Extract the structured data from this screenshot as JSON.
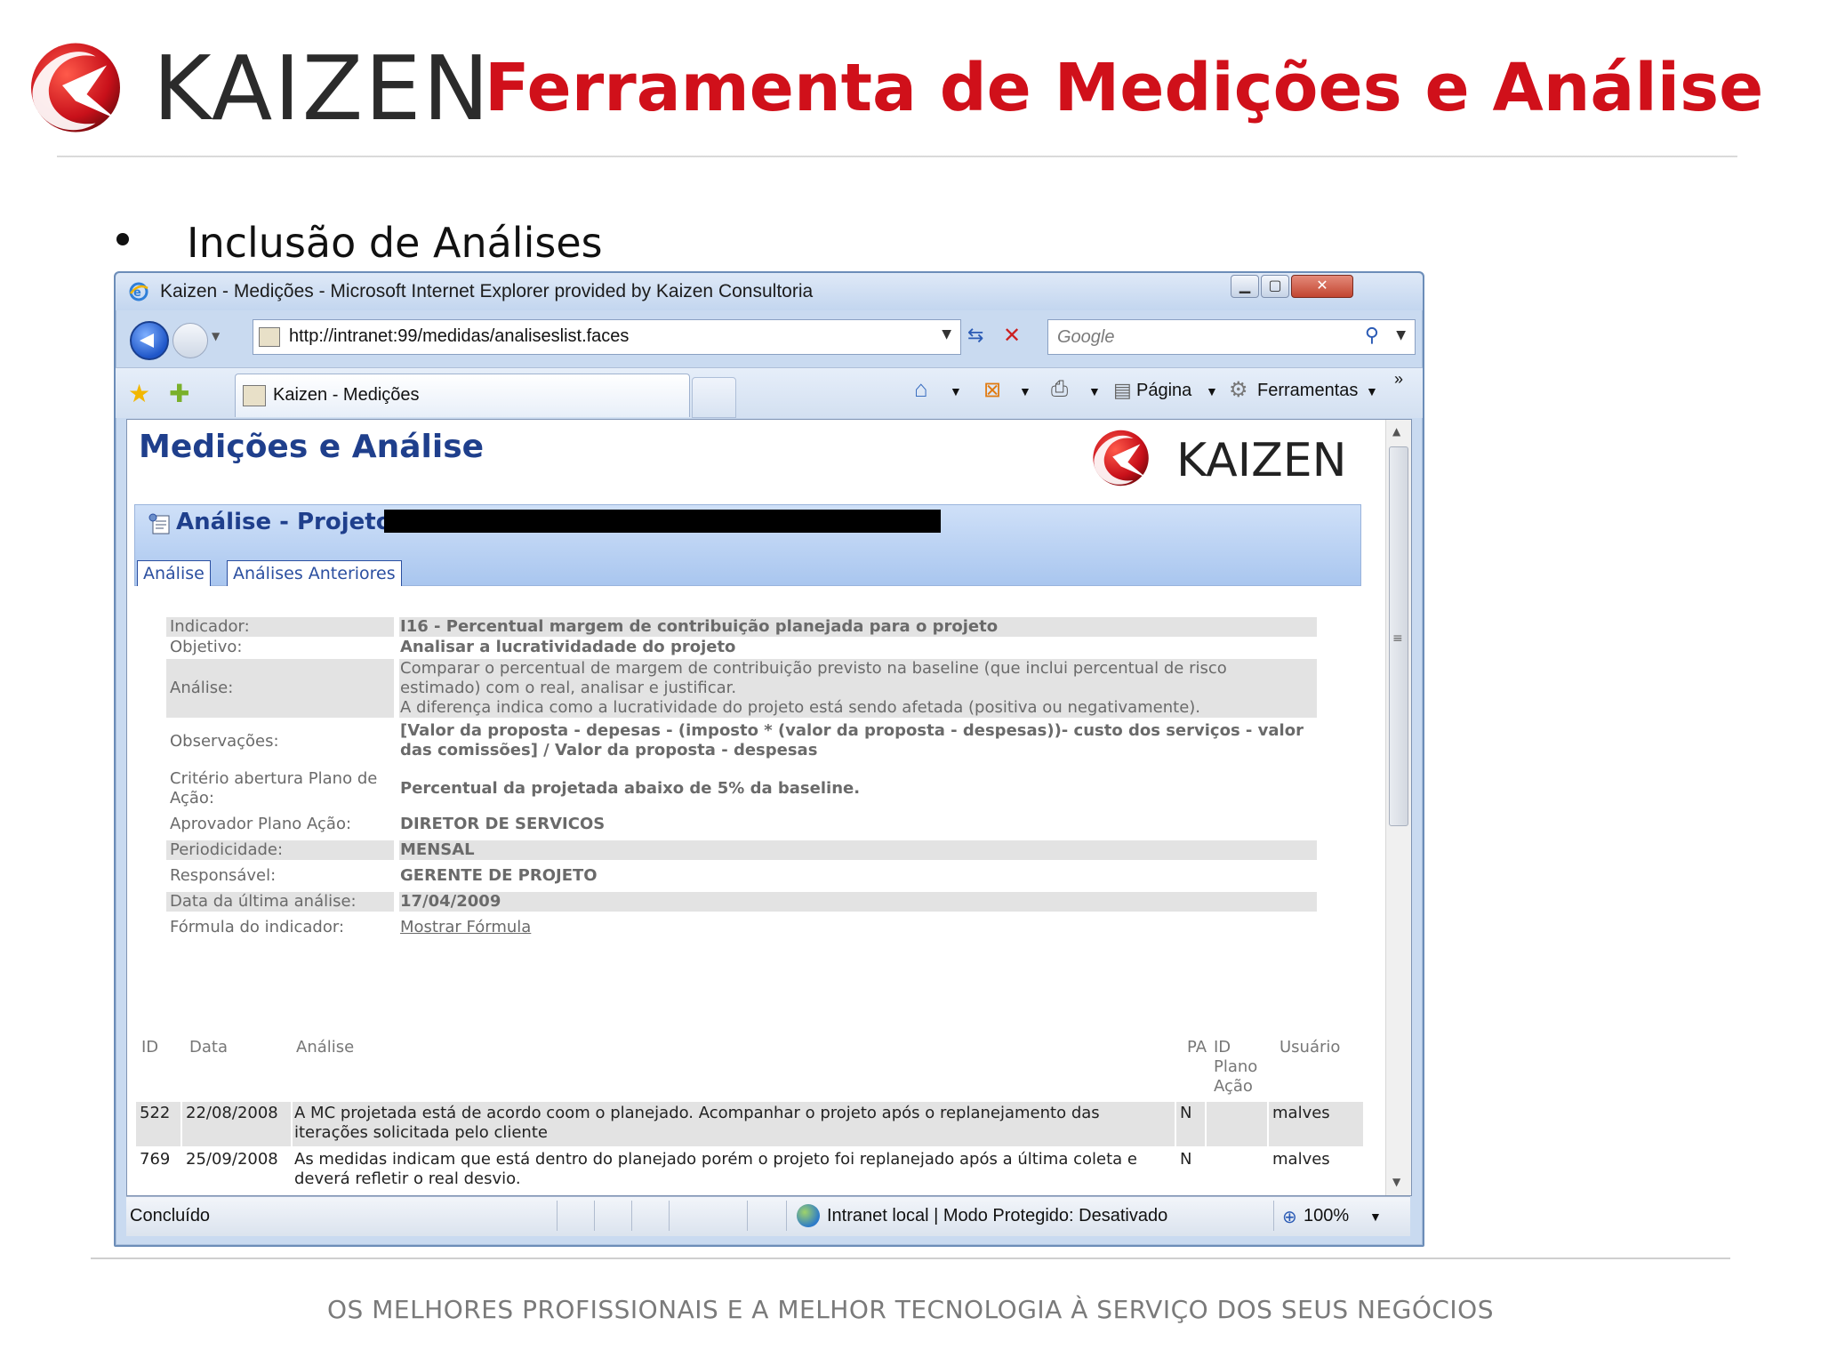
{
  "slide": {
    "brand": "KAIZEN",
    "title": "Ferramenta de Medições e Análise",
    "bullet": "Inclusão de Análises",
    "footer": "OS MELHORES PROFISSIONAIS E A MELHOR TECNOLOGIA À SERVIÇO DOS SEUS NEGÓCIOS",
    "colors": {
      "brand_red": "#d0101a",
      "app_blue": "#1f3f8c"
    }
  },
  "browser": {
    "window_title": "Kaizen - Medições - Microsoft Internet Explorer provided by Kaizen Consultoria",
    "address": "http://intranet:99/medidas/analiseslist.faces",
    "search_placeholder": "Google",
    "tab_label": "Kaizen - Medições",
    "commands": {
      "pagina": "Página",
      "ferramentas": "Ferramentas",
      "overflow": "»"
    },
    "icons": [
      "ie-icon",
      "back-icon",
      "forward-icon",
      "refresh-icon",
      "stop-icon",
      "search-icon",
      "favorites-star-icon",
      "add-favorite-icon",
      "home-icon",
      "feeds-icon",
      "print-icon",
      "page-icon",
      "tools-gear-icon",
      "globe-icon",
      "zoom-icon"
    ],
    "status": {
      "text": "Concluído",
      "zone": "Intranet local | Modo Protegido: Desativado",
      "zoom": "100%"
    }
  },
  "app": {
    "title": "Medições e Análise",
    "logo_text": "KAIZEN",
    "panel_title": "Análise - Projeto:",
    "tabs": [
      "Análise",
      "Análises Anteriores"
    ],
    "fields": [
      {
        "label": "Indicador:",
        "value": "I16 - Percentual margem de contribuição planejada para o projeto"
      },
      {
        "label": "Objetivo:",
        "value": "Analisar a lucratividadade do projeto"
      },
      {
        "label": "Análise:",
        "value": "Comparar o percentual de margem de contribuição previsto na baseline (que inclui percentual de risco estimado) com o real, analisar e justificar.\nA diferença indica como a lucratividade do projeto está sendo afetada (positiva ou negativamente)."
      },
      {
        "label": "Observações:",
        "value": "[Valor da proposta - depesas - (imposto * (valor da proposta - despesas))- custo dos serviços - valor das comissões] / Valor da proposta - despesas"
      },
      {
        "label": "Critério abertura Plano de Ação:",
        "value": "Percentual da projetada abaixo de 5% da baseline."
      },
      {
        "label": "Aprovador Plano Ação:",
        "value": "DIRETOR DE SERVICOS"
      },
      {
        "label": "Periodicidade:",
        "value": "MENSAL"
      },
      {
        "label": "Responsável:",
        "value": "GERENTE DE PROJETO"
      },
      {
        "label": "Data da última análise:",
        "value": "17/04/2009"
      },
      {
        "label": "Fórmula do indicador:",
        "value": "Mostrar Fórmula"
      }
    ],
    "history": {
      "headers": {
        "id": "ID",
        "data": "Data",
        "analise": "Análise",
        "pa": "PA",
        "id_plano": "ID Plano Ação",
        "usuario": "Usuário"
      },
      "rows": [
        {
          "id": "522",
          "data": "22/08/2008",
          "analise": "A MC projetada está de acordo coom o planejado. Acompanhar o projeto após o replanejamento das iterações solicitada pelo cliente",
          "pa": "N",
          "id_plano": "",
          "usuario": "malves"
        },
        {
          "id": "769",
          "data": "25/09/2008",
          "analise": "As medidas indicam que está dentro do planejado porém o projeto foi replanejado após a última coleta e deverá refletir o real desvio.",
          "pa": "N",
          "id_plano": "",
          "usuario": "malves"
        }
      ]
    }
  }
}
